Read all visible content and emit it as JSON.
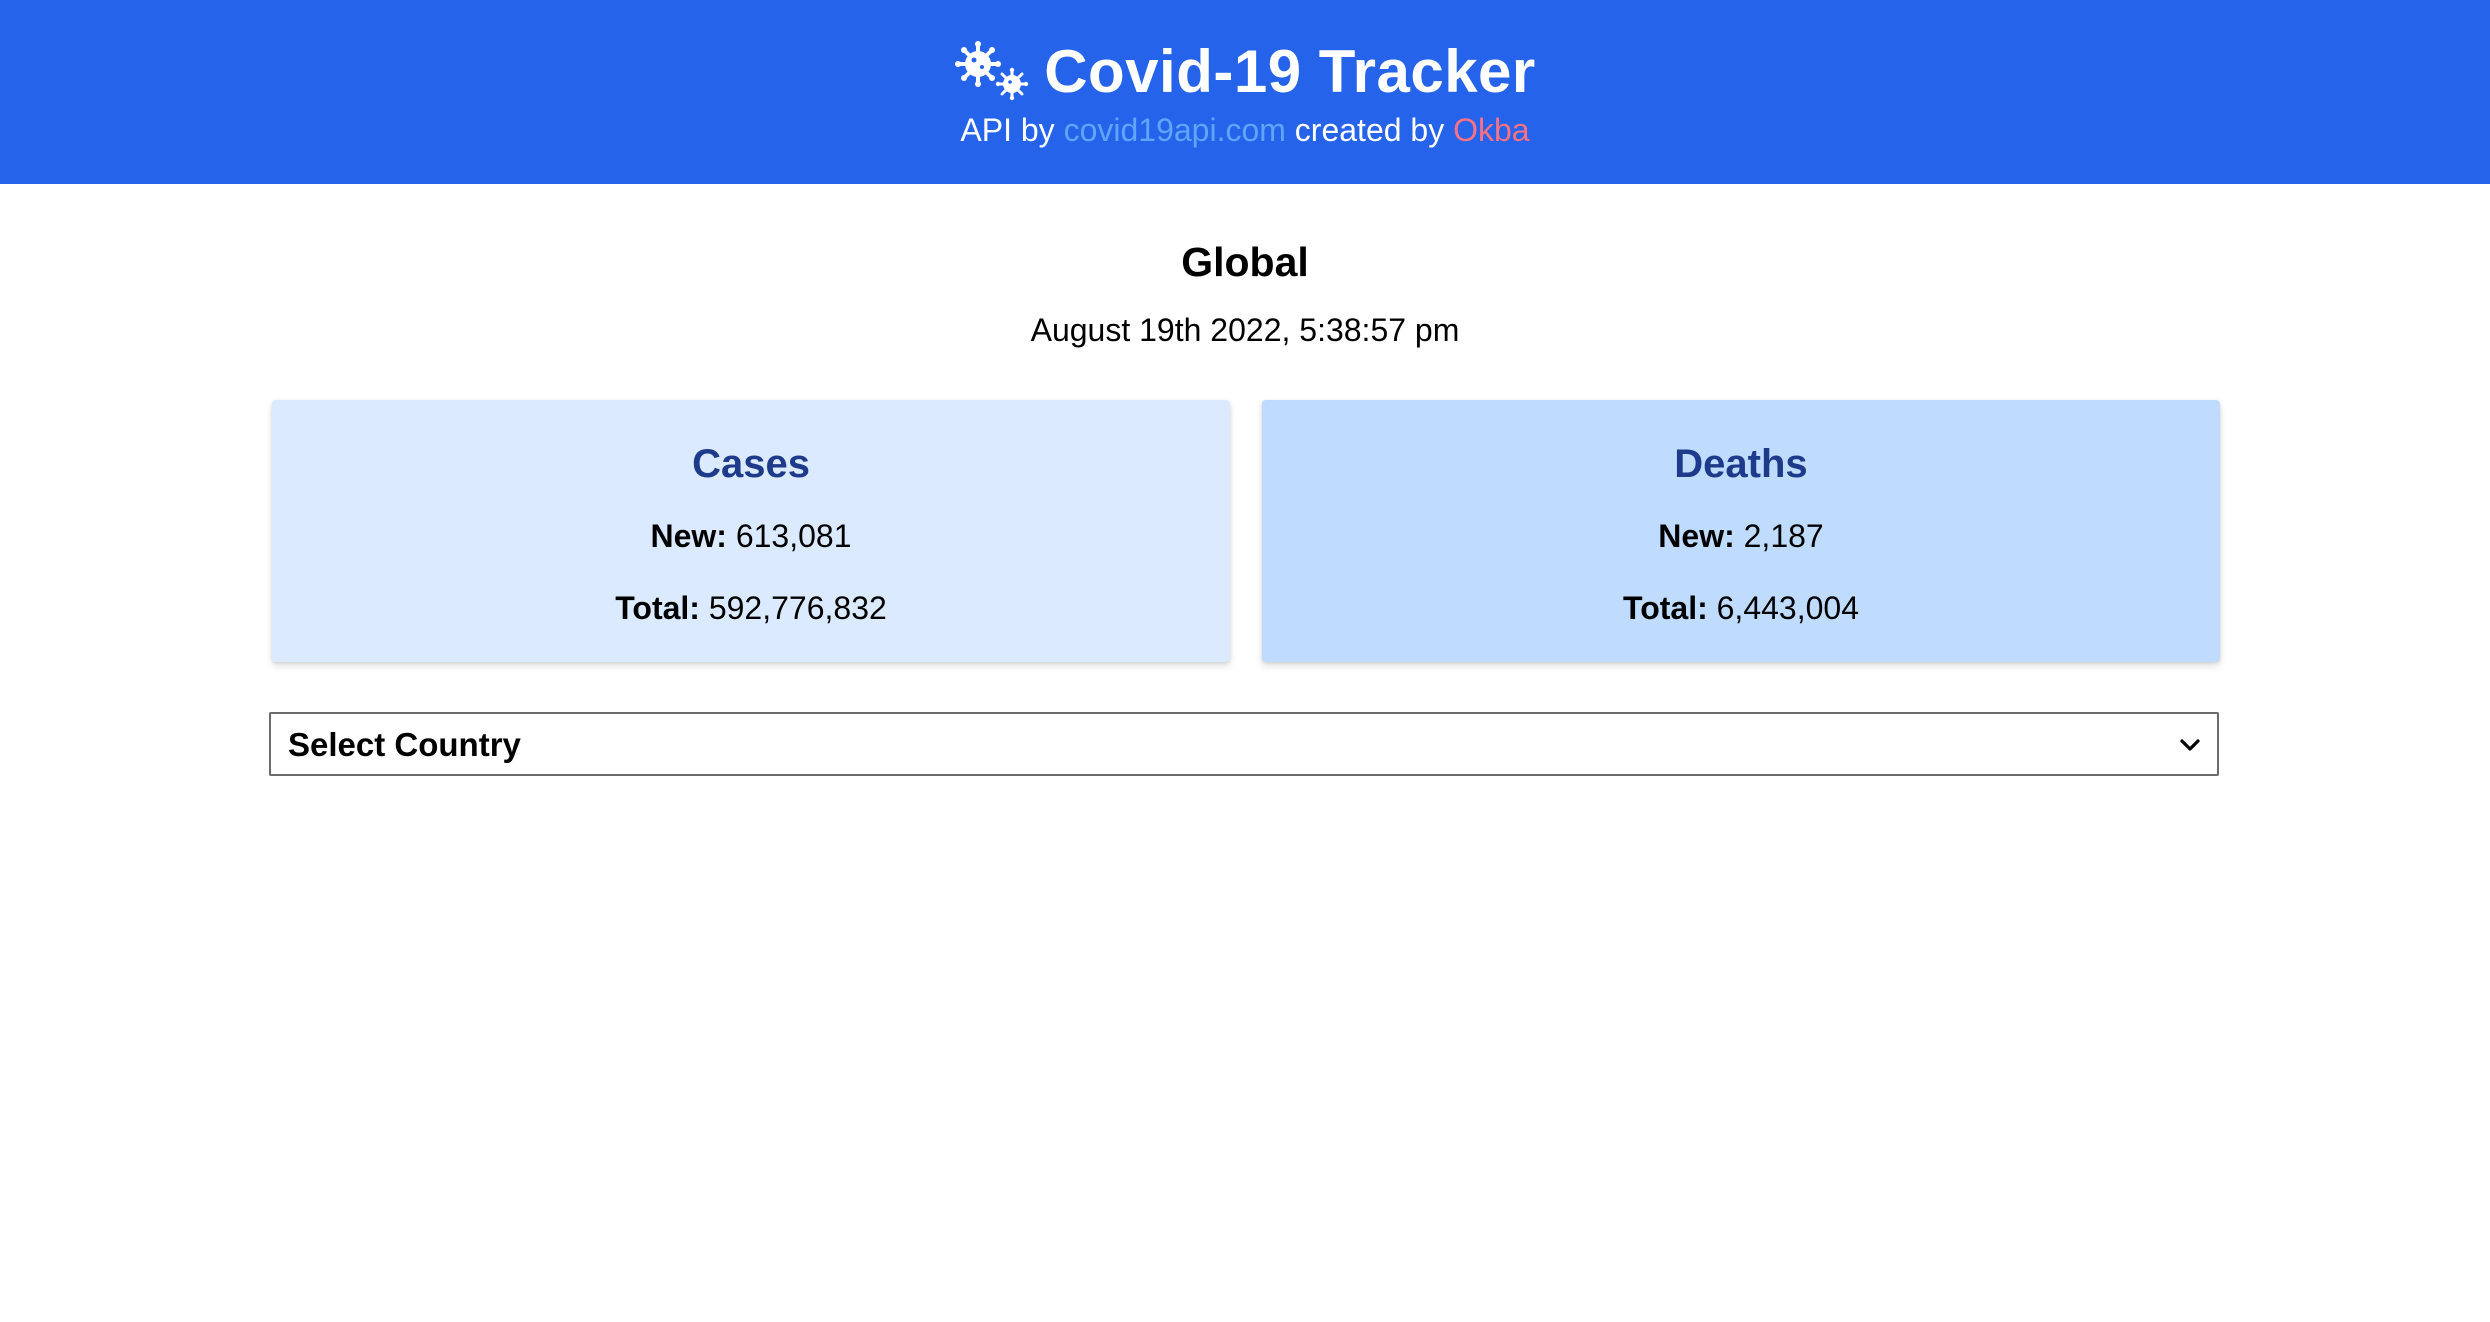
{
  "header": {
    "title": "Covid-19 Tracker",
    "subtitle_prefix": "API by",
    "api_link": "covid19api.com",
    "subtitle_middle": "created by",
    "author_link": "Okba",
    "icon": "virus-icon",
    "colors": {
      "background": "#2563eb",
      "api_link": "#60a5fa",
      "author_link": "#f87185"
    }
  },
  "main": {
    "region": "Global",
    "timestamp": "August 19th 2022, 5:38:57 pm",
    "cards": [
      {
        "title": "Cases",
        "new_label": "New:",
        "new_value": "613,081",
        "total_label": "Total:",
        "total_value": "592,776,832",
        "background": "#dbeafe"
      },
      {
        "title": "Deaths",
        "new_label": "New:",
        "new_value": "2,187",
        "total_label": "Total:",
        "total_value": "6,443,004",
        "background": "#bfdbfe"
      }
    ],
    "country_select": {
      "selected": "Select Country",
      "icon": "chevron-down-icon"
    }
  }
}
